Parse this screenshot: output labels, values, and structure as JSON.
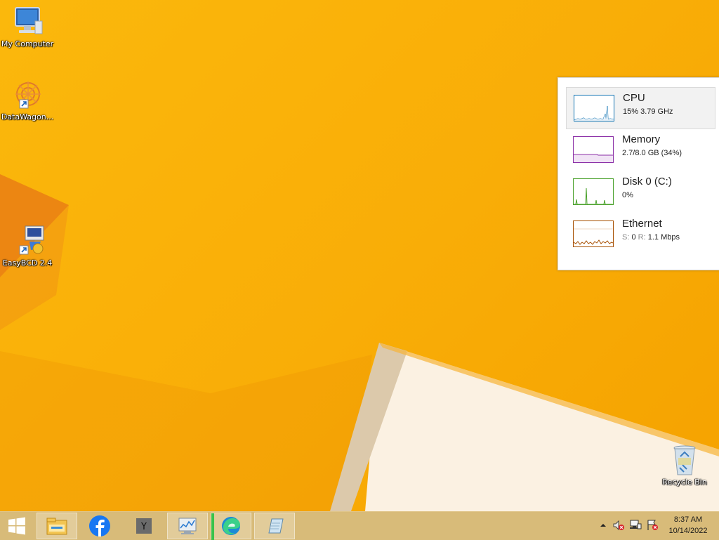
{
  "desktop": {
    "icons": [
      {
        "label": "My Computer",
        "icon": "computer-icon"
      },
      {
        "label": "DataWagon...",
        "icon": "datawagon-icon"
      },
      {
        "label": "EasyBCD 2.4",
        "icon": "easybcd-icon"
      },
      {
        "label": "Recycle Bin",
        "icon": "recycle-bin-icon"
      }
    ]
  },
  "perf": {
    "items": [
      {
        "name": "CPU",
        "value": "15%  3.79 GHz",
        "color": "#1174b3"
      },
      {
        "name": "Memory",
        "value": "2.7/8.0 GB (34%)",
        "color": "#8b2fa7"
      },
      {
        "name": "Disk 0 (C:)",
        "value": "0%",
        "color": "#4aa12b"
      },
      {
        "name": "Ethernet",
        "value_s_label": "S:",
        "value_s": "0",
        "value_r_label": "R:",
        "value_r": "1.1 Mbps",
        "color": "#a74f01"
      }
    ]
  },
  "taskbar": {
    "start_icon": "windows-logo-icon",
    "apps": [
      "file-explorer-icon",
      "facebook-icon",
      "yahoo-icon",
      "resource-monitor-icon",
      "edge-icon",
      "notepad-icon"
    ],
    "tray": [
      "show-hidden-icons-icon",
      "speaker-muted-icon",
      "network-icon",
      "action-center-icon"
    ],
    "time": "8:37 AM",
    "date": "10/14/2022"
  },
  "colors": {
    "wallpaper": "#fbb80c",
    "taskbar": "#d6b874",
    "accent": "#1174b3"
  }
}
